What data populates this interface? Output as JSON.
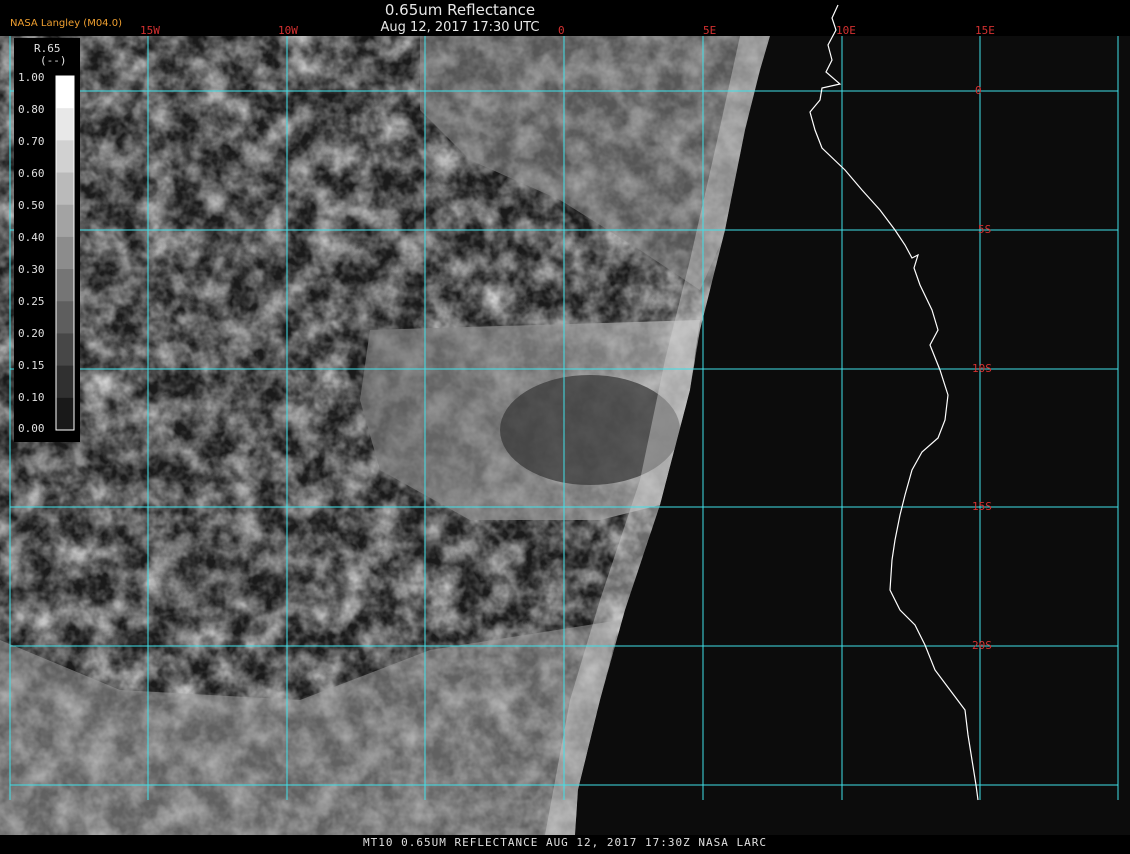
{
  "header": {
    "title": "0.65um Reflectance",
    "subtitle": "Aug 12, 2017 17:30 UTC",
    "brand": "NASA Langley (M04.0)"
  },
  "footer": {
    "caption": "MT10  0.65UM REFLECTANCE   AUG 12, 2017 17:30Z   NASA LARC"
  },
  "map": {
    "longitude_labels": [
      "15W",
      "10W",
      "0",
      "5E",
      "10E",
      "15E"
    ],
    "latitude_labels": [
      "0",
      "5S",
      "10S",
      "15S",
      "20S"
    ],
    "gridline_color": "#40e0e8",
    "label_color": "#d43030",
    "coastline_color": "#ffffff"
  },
  "colorbar": {
    "name": "R.65",
    "units": "(--)",
    "ticks": [
      "1.00",
      "0.80",
      "0.70",
      "0.60",
      "0.50",
      "0.40",
      "0.30",
      "0.25",
      "0.20",
      "0.15",
      "0.10",
      "0.00"
    ]
  }
}
